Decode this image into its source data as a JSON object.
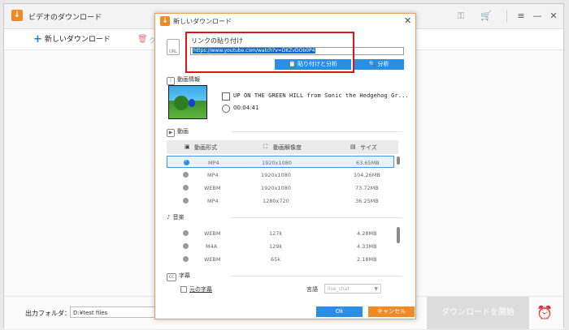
{
  "app": {
    "title": "ビデオのダウンロード",
    "new_download_label": "新しいダウンロード",
    "trash_label": "ク",
    "output_folder_label": "出力フォルダ：",
    "output_folder_value": "D:¥test files",
    "download_all_label": "ダウンロードを開始"
  },
  "dialog": {
    "title": "新しいダウンロード",
    "url_label": "リンクの貼り付け",
    "url_value": "https://www.youtube.com/watch?v=DKZvDOb0P4",
    "paste_analyze_label": "貼り付けと分析",
    "analyze_label": "分析",
    "video_info_heading": "動画情報",
    "video_title": "UP ON THE GREEN HILL from Sonic the Hedgehog Gr...",
    "duration": "00:04:41",
    "video_section_heading": "動画",
    "video_columns": [
      "動画形式",
      "動画解像度",
      "サイズ"
    ],
    "video_rows": [
      {
        "format": "MP4",
        "resolution": "1920x1080",
        "size": "63.65MB",
        "selected": true
      },
      {
        "format": "MP4",
        "resolution": "1920x1080",
        "size": "104.26MB",
        "selected": false
      },
      {
        "format": "WEBM",
        "resolution": "1920x1080",
        "size": "73.72MB",
        "selected": false
      },
      {
        "format": "MP4",
        "resolution": "1280x720",
        "size": "36.25MB",
        "selected": false
      }
    ],
    "audio_section_heading": "音楽",
    "audio_rows": [
      {
        "format": "WEBM",
        "bitrate": "127k",
        "size": "4.28MB"
      },
      {
        "format": "M4A",
        "bitrate": "129k",
        "size": "4.33MB"
      },
      {
        "format": "WEBM",
        "bitrate": "65k",
        "size": "2.18MB"
      }
    ],
    "subtitle_section_heading": "字幕",
    "original_subtitle_label": "元の字幕",
    "language_label": "言語",
    "language_value": "live_chat",
    "ok_label": "Ok",
    "cancel_label": "キャンセル"
  },
  "colors": {
    "accent_blue": "#2a8fe0",
    "accent_orange": "#f08a24",
    "highlight_red": "#d91515"
  }
}
